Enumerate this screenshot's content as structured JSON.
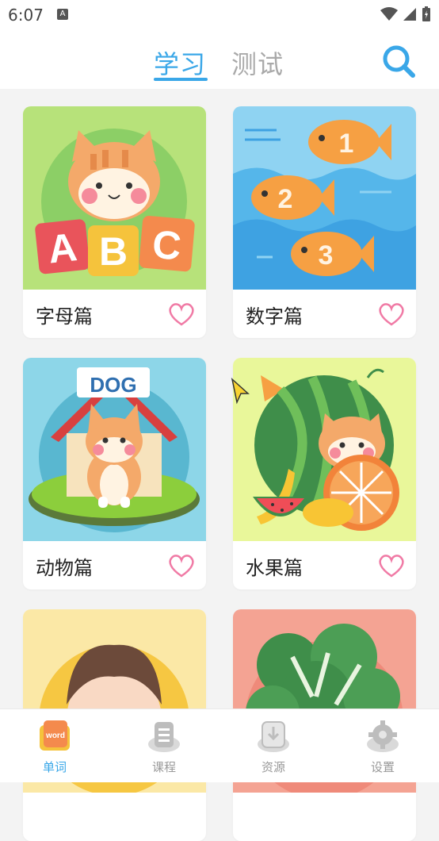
{
  "status": {
    "time": "6:07",
    "notif": "A"
  },
  "header": {
    "tabs": [
      {
        "label": "学习",
        "active": true
      },
      {
        "label": "测试",
        "active": false
      }
    ],
    "search_icon": "search-icon"
  },
  "cards": [
    {
      "title": "字母篇",
      "art_text": [
        "A",
        "B",
        "C"
      ]
    },
    {
      "title": "数字篇",
      "art_text": [
        "1",
        "2",
        "3"
      ]
    },
    {
      "title": "动物篇",
      "art_text": [
        "DOG"
      ]
    },
    {
      "title": "水果篇"
    },
    {
      "title": ""
    },
    {
      "title": ""
    }
  ],
  "bottom_nav": [
    {
      "label": "单词",
      "active": true,
      "badge": "word"
    },
    {
      "label": "课程",
      "active": false
    },
    {
      "label": "资源",
      "active": false
    },
    {
      "label": "设置",
      "active": false
    }
  ],
  "colors": {
    "accent": "#3aa7e8",
    "heart": "#f07aa5",
    "inactive_tab": "#a9a9a9"
  }
}
